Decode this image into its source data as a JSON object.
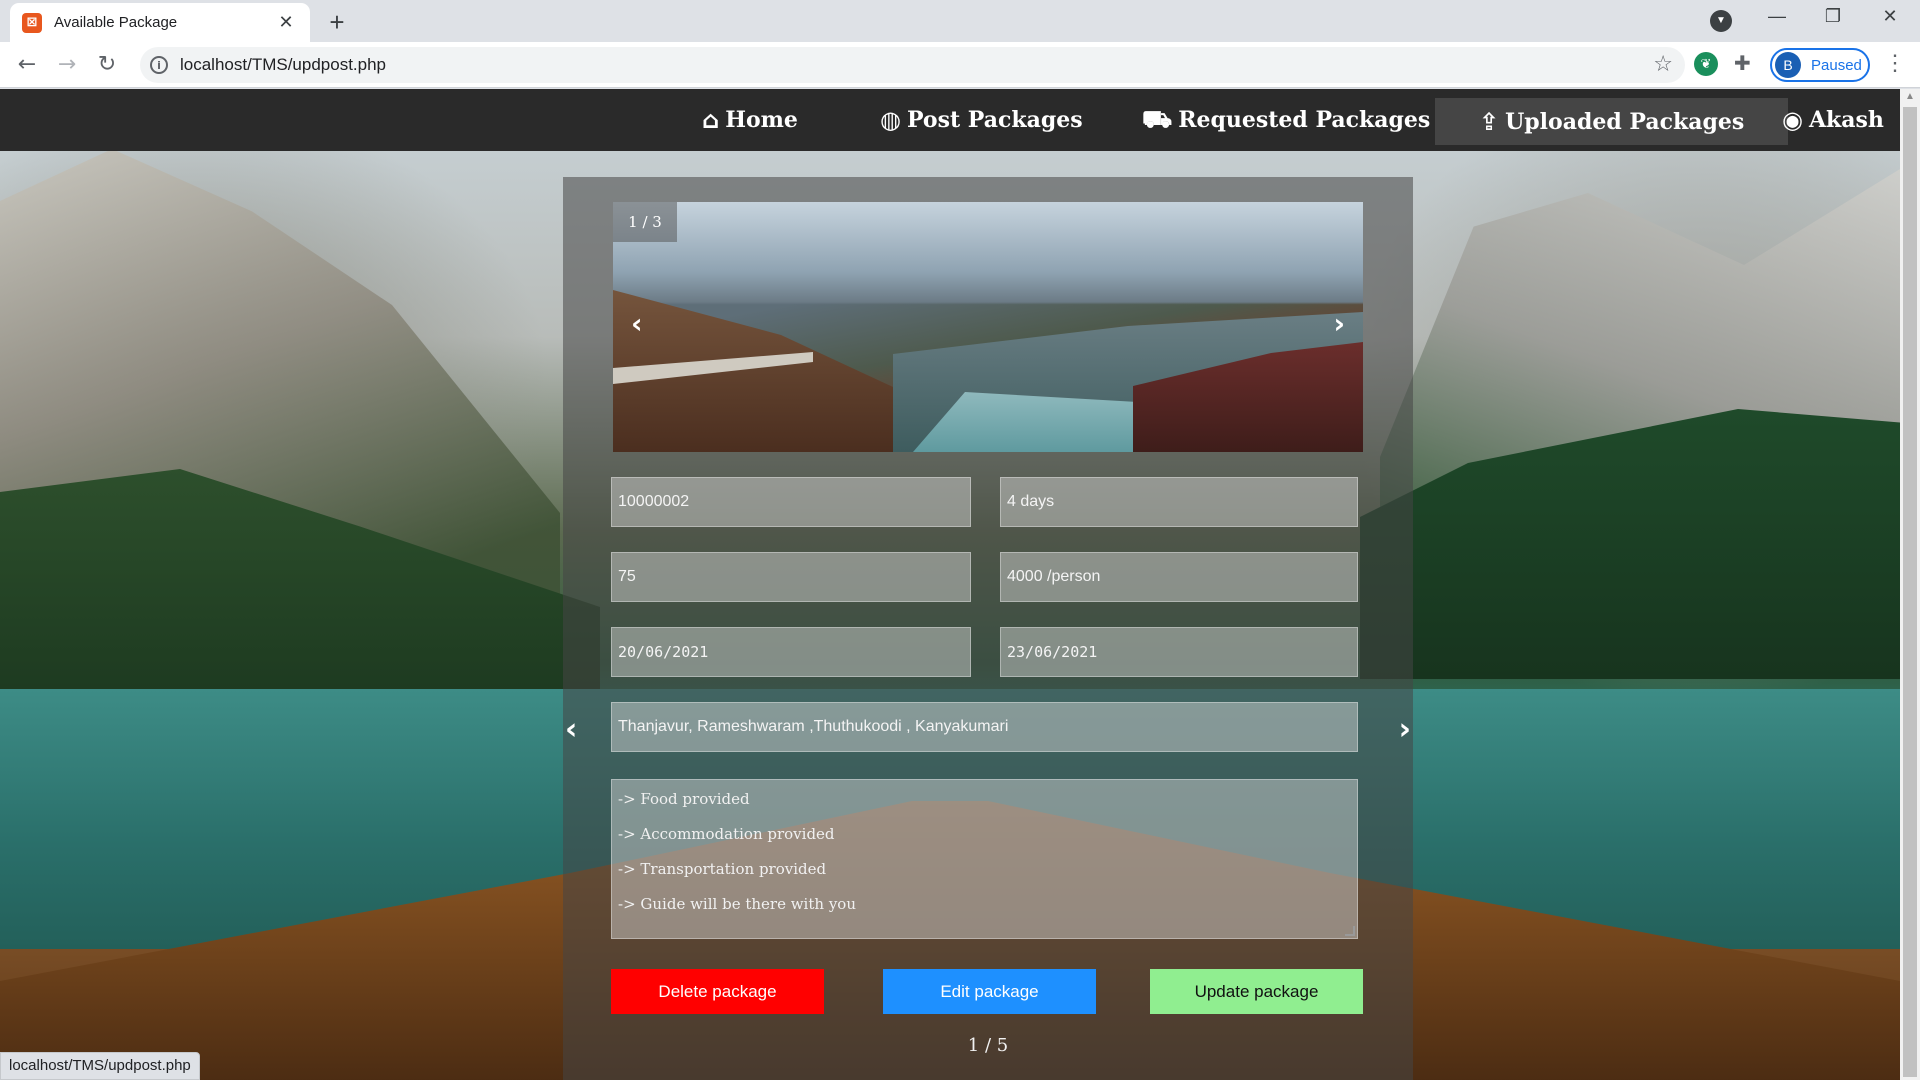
{
  "browser": {
    "tab_title": "Available Package",
    "url": "localhost/TMS/updpost.php",
    "profile_initial": "B",
    "profile_status": "Paused",
    "status_bar_url": "localhost/TMS/updpost.php"
  },
  "nav": {
    "items": [
      {
        "label": "Home",
        "icon": "home-icon"
      },
      {
        "label": "Post Packages",
        "icon": "globe-icon"
      },
      {
        "label": "Requested Packages",
        "icon": "cart-icon"
      },
      {
        "label": "Uploaded Packages",
        "icon": "upload-icon",
        "active": true
      },
      {
        "label": "Akash",
        "icon": "user-icon"
      }
    ]
  },
  "package": {
    "image_counter": "1 / 3",
    "id": "10000002",
    "duration": "4 days",
    "seats": "75",
    "price": "4000 /person",
    "start_date": "20/06/2021",
    "end_date": "23/06/2021",
    "places": "Thanjavur, Rameshwaram ,Thuthukoodi , Kanyakumari",
    "description_lines": [
      "-> Food provided",
      "-> Accommodation provided",
      "-> Transportation provided",
      "-> Guide will be there with you"
    ],
    "page_counter": "1 / 5"
  },
  "buttons": {
    "delete": "Delete package",
    "edit": "Edit package",
    "update": "Update package"
  },
  "colors": {
    "delete": "#ff0000",
    "edit": "#1e90ff",
    "update": "#90ee90",
    "nav_bg": "#2a2a2a"
  }
}
